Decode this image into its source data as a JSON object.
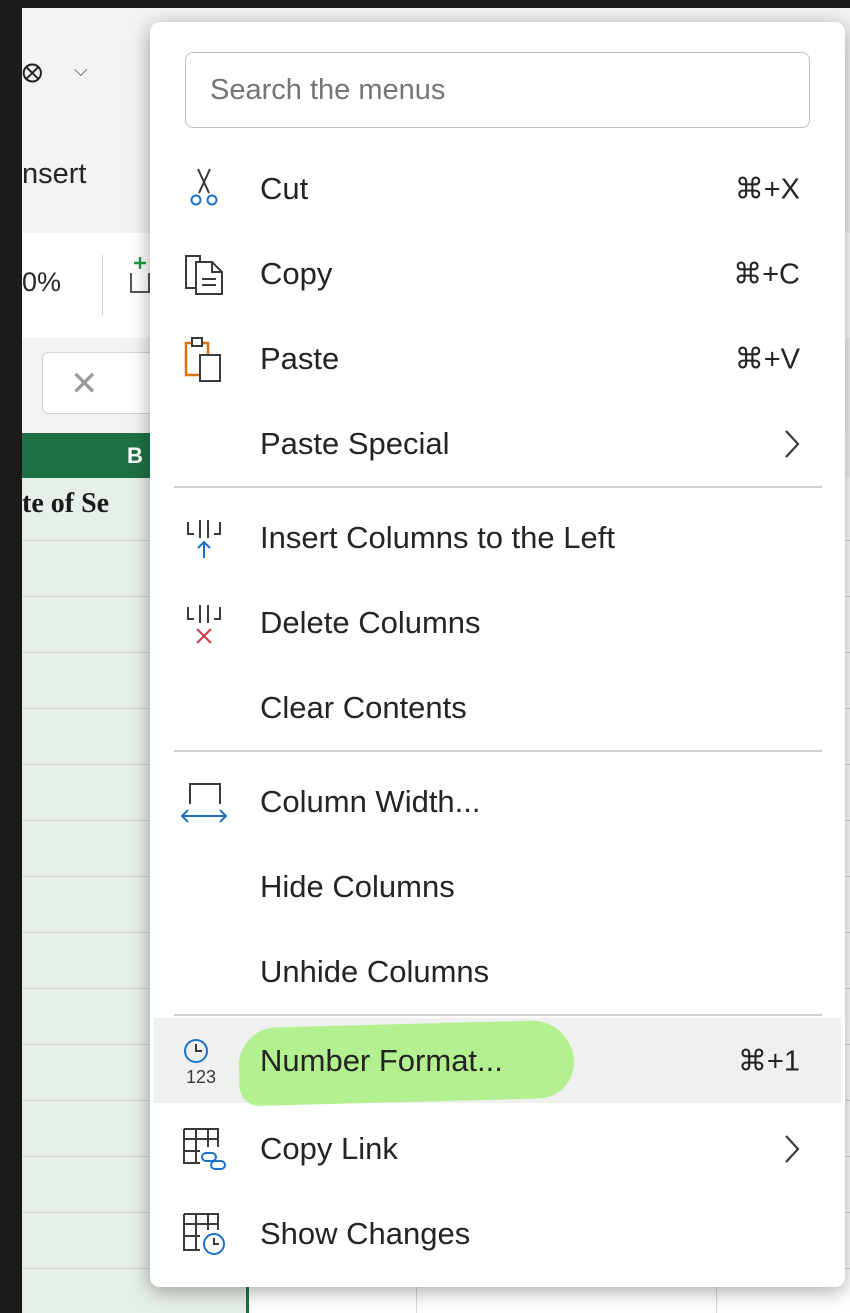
{
  "background": {
    "tab_label": "nsert",
    "zoom_text": "0%",
    "column_header": "B",
    "cell_text": "te of Se"
  },
  "context_menu": {
    "search_placeholder": "Search the menus",
    "items": [
      {
        "label": "Cut",
        "shortcut": "⌘+X",
        "icon": "scissors-icon"
      },
      {
        "label": "Copy",
        "shortcut": "⌘+C",
        "icon": "copy-icon"
      },
      {
        "label": "Paste",
        "shortcut": "⌘+V",
        "icon": "paste-icon"
      },
      {
        "label": "Paste Special",
        "submenu": true
      },
      {
        "label": "Insert Columns to the Left",
        "icon": "insert-columns-icon"
      },
      {
        "label": "Delete Columns",
        "icon": "delete-columns-icon"
      },
      {
        "label": "Clear Contents"
      },
      {
        "label": "Column Width...",
        "icon": "column-width-icon"
      },
      {
        "label": "Hide Columns"
      },
      {
        "label": "Unhide Columns"
      },
      {
        "label": "Number Format...",
        "shortcut": "⌘+1",
        "icon": "number-format-icon",
        "highlighted": true
      },
      {
        "label": "Copy Link",
        "submenu": true,
        "icon": "copy-link-icon"
      },
      {
        "label": "Show Changes",
        "icon": "show-changes-icon"
      }
    ]
  },
  "colors": {
    "excel_green": "#1e7145",
    "highlighter": "#a8f07f",
    "paste_orange": "#d9700f",
    "icon_blue": "#1a73c8",
    "delete_red": "#d13438"
  }
}
